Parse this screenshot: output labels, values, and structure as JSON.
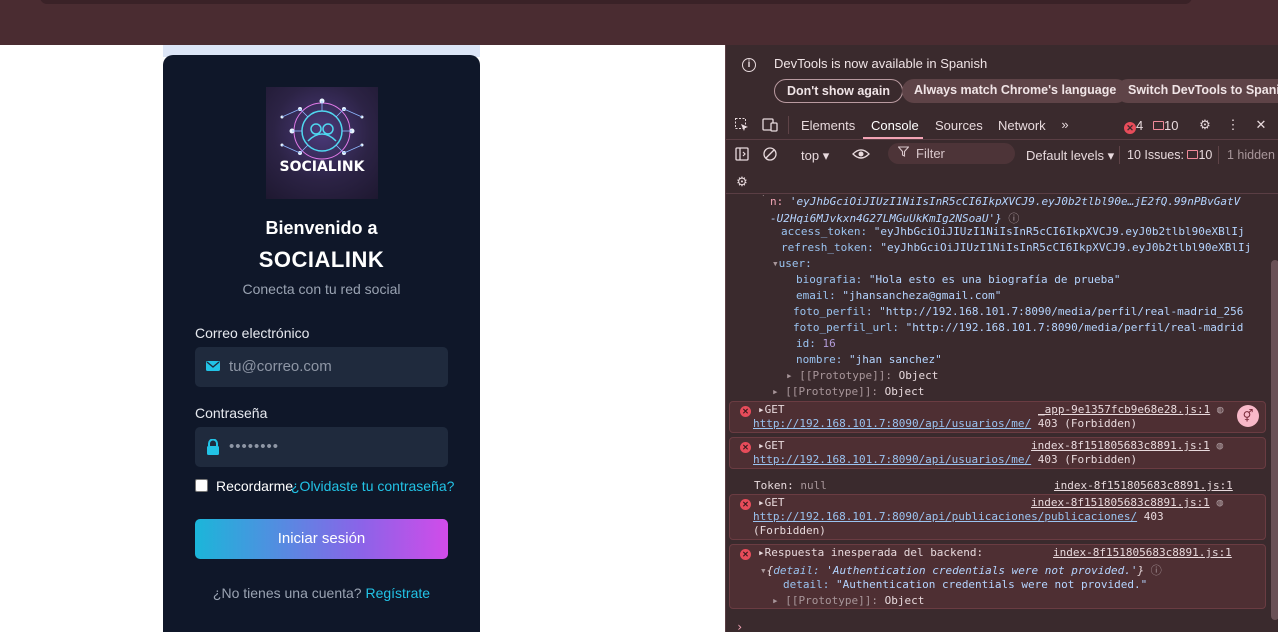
{
  "login": {
    "logo_text": "SOCIALINK",
    "welcome": "Bienvenido a",
    "brand": "SOCIALINK",
    "subtitle": "Conecta con tu red social",
    "email_label": "Correo electrónico",
    "email_placeholder": "tu@correo.com",
    "password_label": "Contraseña",
    "password_value": "••••••••",
    "remember_label": "Recordarme",
    "forgot_link": "¿Olvidaste tu contraseña?",
    "login_button": "Iniciar sesión",
    "signup_prompt": "¿No tienes una cuenta? ",
    "signup_link": "Regístrate"
  },
  "devtools": {
    "info_text": "DevTools is now available in Spanish",
    "btn_dont_show": "Don't show again",
    "btn_always_match": "Always match Chrome's language",
    "btn_switch": "Switch DevTools to Spanish",
    "tabs": [
      "Elements",
      "Console",
      "Sources",
      "Network"
    ],
    "error_count": "4",
    "message_count": "10",
    "context": "top",
    "filter_placeholder": "Filter",
    "levels": "Default levels",
    "issues_label": "10 Issues:",
    "issues_count": "10",
    "hidden_label": "1 hidden"
  },
  "console": {
    "token_line_key": "n:",
    "token_line_value": "'eyJhbGciOiJIUzI1NiIsInR5cCI6IkpXVCJ9.eyJ0b2tlbl90e…jE2fQ.99nPBvGatV",
    "token_line_value2": "-U2Hqi6MJvkxn4G27LMGuUkKmIg2NSoaU'}",
    "access_key": "access_token:",
    "access_value": "\"eyJhbGciOiJIUzI1NiIsInR5cCI6IkpXVCJ9.eyJ0b2tlbl90eXBlIj",
    "refresh_key": "refresh_token:",
    "refresh_value": "\"eyJhbGciOiJIUzI1NiIsInR5cCI6IkpXVCJ9.eyJ0b2tlbl90eXBlIj",
    "user_key": "user:",
    "biografia_key": "biografia:",
    "biografia_value": "\"Hola esto es una biografía de prueba\"",
    "email_key": "email:",
    "email_value": "\"jhansancheza@gmail.com\"",
    "foto_key": "foto_perfil:",
    "foto_value": "\"http://192.168.101.7:8090/media/perfil/real-madrid_256",
    "foto_url_key": "foto_perfil_url:",
    "foto_url_value": "\"http://192.168.101.7:8090/media/perfil/real-madrid",
    "id_key": "id:",
    "id_value": "16",
    "nombre_key": "nombre:",
    "nombre_value": "\"jhan sanchez\"",
    "prototype_key": "[[Prototype]]:",
    "prototype_value": "Object",
    "get": "GET",
    "err1_src": "_app-9e1357fcb9e68e28.js:1",
    "err1_url": "http://192.168.101.7:8090/api/usuarios/me/",
    "err1_status": "403 (Forbidden)",
    "err2_src": "index-8f151805683c8891.js:1",
    "err2_url": "http://192.168.101.7:8090/api/usuarios/me/",
    "err2_status": "403 (Forbidden)",
    "token_log": "Token:",
    "token_null": "null",
    "token_src": "index-8f151805683c8891.js:1",
    "err3_src": "index-8f151805683c8891.js:1",
    "err3_url": "http://192.168.101.7:8090/api/publicaciones/publicaciones/",
    "err3_status": "403",
    "err3_status2": "(Forbidden)",
    "err4_text": "Respuesta inesperada del backend:",
    "err4_src": "index-8f151805683c8891.js:1",
    "err4_obj_open": "{",
    "err4_obj_key": "detail:",
    "err4_obj_val": "'Authentication credentials were not provided.'",
    "err4_obj_close": "}",
    "detail_key": "detail:",
    "detail_value": "\"Authentication credentials were not provided.\""
  }
}
